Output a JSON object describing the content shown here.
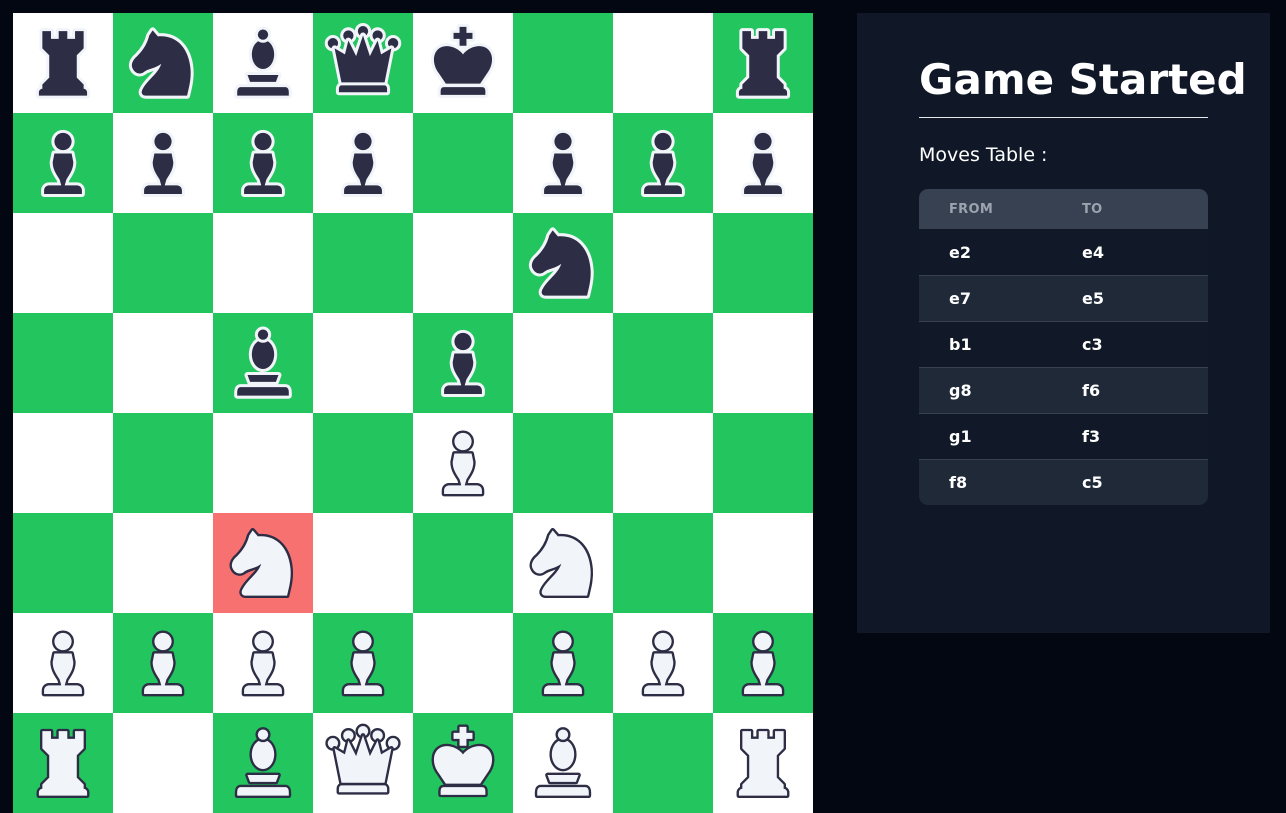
{
  "board": {
    "highlight_square": "c3",
    "colors": {
      "light": "#ffffff",
      "dark": "#22c55e",
      "highlight": "#f87171",
      "black_piece": "#2d2d45",
      "white_piece": "#f1f5f9"
    },
    "ranks": [
      [
        "br",
        "bn",
        "bb",
        "bq",
        "bk",
        "",
        "",
        "br"
      ],
      [
        "bp",
        "bp",
        "bp",
        "bp",
        "",
        "bp",
        "bp",
        "bp"
      ],
      [
        "",
        "",
        "",
        "",
        "",
        "bn",
        "",
        ""
      ],
      [
        "",
        "",
        "bb",
        "",
        "bp",
        "",
        "",
        ""
      ],
      [
        "",
        "",
        "",
        "",
        "wp",
        "",
        "",
        ""
      ],
      [
        "",
        "",
        "wn",
        "",
        "",
        "wn",
        "",
        ""
      ],
      [
        "wp",
        "wp",
        "wp",
        "wp",
        "",
        "wp",
        "wp",
        "wp"
      ],
      [
        "wr",
        "",
        "wb",
        "wq",
        "wk",
        "wb",
        "",
        "wr"
      ]
    ]
  },
  "panel": {
    "title": "Game Started",
    "moves_label": "Moves Table :",
    "table": {
      "headers": {
        "from": "FROM",
        "to": "TO"
      },
      "rows": [
        {
          "from": "e2",
          "to": "e4"
        },
        {
          "from": "e7",
          "to": "e5"
        },
        {
          "from": "b1",
          "to": "c3"
        },
        {
          "from": "g8",
          "to": "f6"
        },
        {
          "from": "g1",
          "to": "f3"
        },
        {
          "from": "f8",
          "to": "c5"
        }
      ]
    }
  }
}
